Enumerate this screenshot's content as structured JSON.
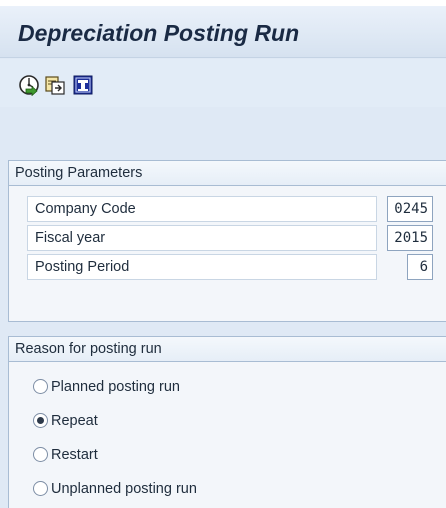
{
  "header": {
    "title": "Depreciation Posting Run"
  },
  "toolbar": {
    "buttons": [
      {
        "icon": "execute-icon",
        "name": "execute"
      },
      {
        "icon": "get-variant-icon",
        "name": "get-variant"
      },
      {
        "icon": "program-documentation-icon",
        "name": "documentation"
      }
    ]
  },
  "posting_parameters": {
    "header": "Posting Parameters",
    "company_code": {
      "label": "Company Code",
      "value": "0245"
    },
    "fiscal_year": {
      "label": "Fiscal year",
      "value": "2015"
    },
    "posting_period": {
      "label": "Posting Period",
      "value": "6"
    }
  },
  "reason": {
    "header": "Reason for posting run",
    "options": [
      {
        "label": "Planned posting run",
        "selected": false
      },
      {
        "label": "Repeat",
        "selected": true
      },
      {
        "label": "Restart",
        "selected": false
      },
      {
        "label": "Unplanned posting run",
        "selected": false
      }
    ]
  },
  "colors": {
    "background": "#dfe9f5",
    "group_border": "#a8bcd3",
    "title_text": "#1a2a44",
    "execute_green": "#3f9a2e",
    "info_blue": "#1d2f9a"
  }
}
